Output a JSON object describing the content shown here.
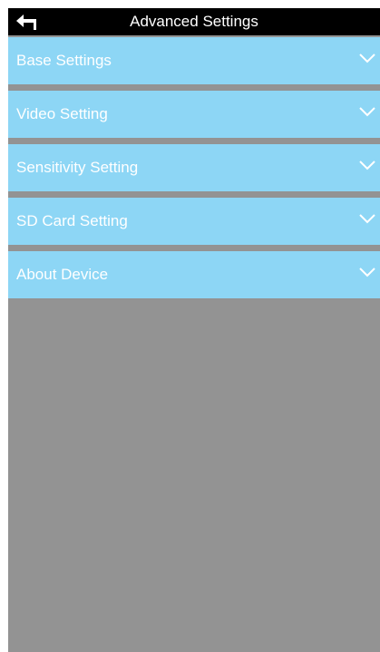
{
  "header": {
    "title": "Advanced Settings",
    "back_icon": "back-arrow-icon"
  },
  "menu": {
    "items": [
      {
        "label": "Base Settings",
        "icon": "chevron-down-icon"
      },
      {
        "label": "Video Setting",
        "icon": "chevron-down-icon"
      },
      {
        "label": "Sensitivity Setting",
        "icon": "chevron-down-icon"
      },
      {
        "label": "SD Card Setting",
        "icon": "chevron-down-icon"
      },
      {
        "label": "About Device",
        "icon": "chevron-down-icon"
      }
    ]
  },
  "colors": {
    "header_bg": "#000000",
    "item_bg": "#8dd6f5",
    "page_bg": "#939393",
    "text": "#ffffff"
  }
}
